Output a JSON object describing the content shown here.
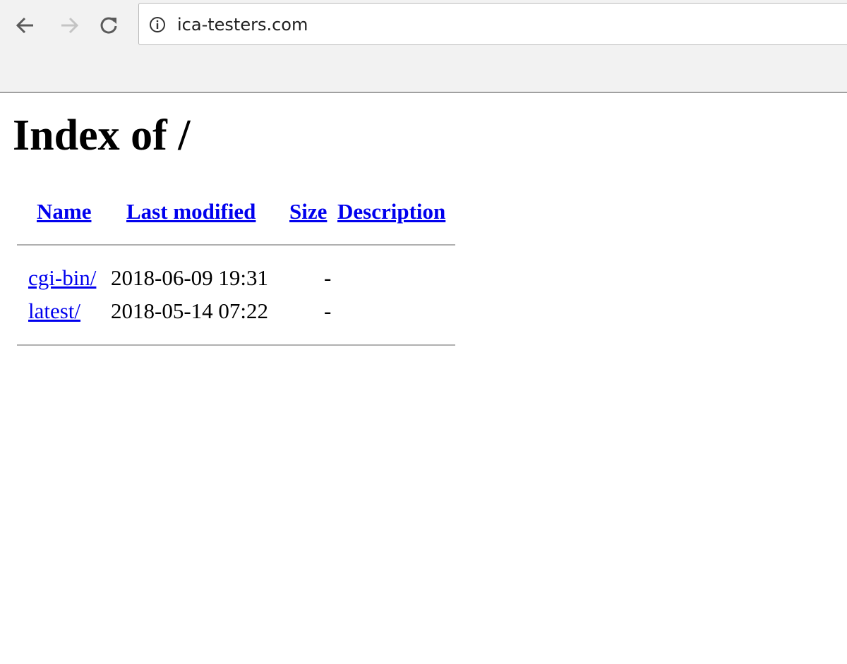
{
  "browser": {
    "url": "ica-testers.com",
    "icons": {
      "back": "arrow-left-icon",
      "forward": "arrow-right-icon",
      "reload": "reload-icon",
      "site_info": "info-icon"
    }
  },
  "page": {
    "title": "Index of /",
    "columns": [
      "Name",
      "Last modified",
      "Size",
      "Description"
    ],
    "rows": [
      {
        "name": "cgi-bin/",
        "modified": "2018-06-09 19:31",
        "size": "-",
        "description": ""
      },
      {
        "name": "latest/",
        "modified": "2018-05-14 07:22",
        "size": "-",
        "description": ""
      }
    ]
  },
  "colors": {
    "link": "#0000ee",
    "chrome_bg": "#f2f2f2"
  }
}
